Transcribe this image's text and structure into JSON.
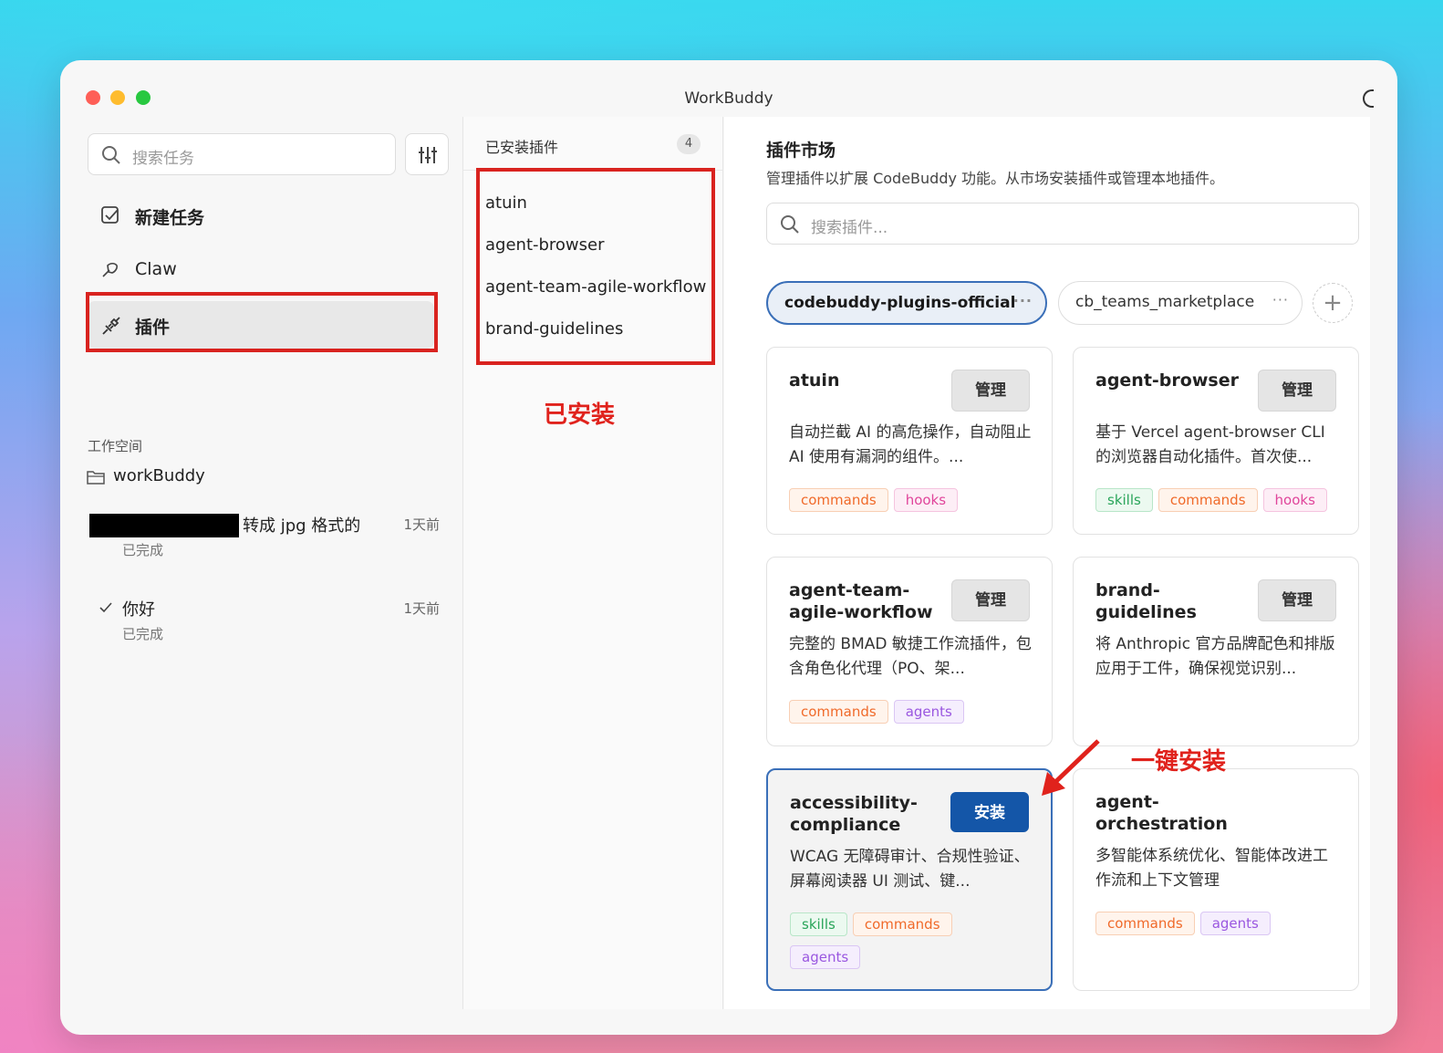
{
  "window": {
    "title": "WorkBuddy"
  },
  "sidebar": {
    "search_placeholder": "搜索任务",
    "nav": [
      {
        "label": "新建任务",
        "icon": "new-task-icon"
      },
      {
        "label": "Claw",
        "icon": "claw-icon"
      },
      {
        "label": "插件",
        "icon": "plugin-icon"
      }
    ],
    "workspace_label": "工作空间",
    "workspace_folder": "workBuddy",
    "tasks": [
      {
        "title": "转成 jpg 格式的",
        "time": "1天前",
        "status": "已完成"
      },
      {
        "title": "你好",
        "time": "1天前",
        "status": "已完成"
      }
    ]
  },
  "installed": {
    "header": "已安装插件",
    "count": "4",
    "items": [
      "atuin",
      "agent-browser",
      "agent-team-agile-workflow",
      "brand-guidelines"
    ],
    "annotation": "已安装"
  },
  "market": {
    "title": "插件市场",
    "description": "管理插件以扩展 CodeBuddy 功能。从市场安装插件或管理本地插件。",
    "search_placeholder": "搜索插件...",
    "sources": [
      "codebuddy-plugins-official",
      "cb_teams_marketplace"
    ],
    "add_label": "+",
    "annotation": "一键安装",
    "cards": [
      {
        "name": "atuin",
        "button": "管理",
        "description": "自动拦截 AI 的高危操作，自动阻止 AI 使用有漏洞的组件。...",
        "tags": [
          "commands",
          "hooks"
        ]
      },
      {
        "name": "agent-browser",
        "button": "管理",
        "description": "基于 Vercel agent-browser CLI 的浏览器自动化插件。首次使...",
        "tags": [
          "skills",
          "commands",
          "hooks"
        ]
      },
      {
        "name": "agent-team-agile-workflow",
        "button": "管理",
        "description": "完整的 BMAD 敏捷工作流插件，包含角色化代理（PO、架...",
        "tags": [
          "commands",
          "agents"
        ]
      },
      {
        "name": "brand-guidelines",
        "button": "管理",
        "description": "将 Anthropic 官方品牌配色和排版应用于工件，确保视觉识别...",
        "tags": []
      },
      {
        "name": "accessibility-compliance",
        "button": "安装",
        "description": "WCAG 无障碍审计、合规性验证、屏幕阅读器 UI 测试、键...",
        "tags": [
          "skills",
          "commands",
          "agents"
        ]
      },
      {
        "name": "agent-orchestration",
        "button": "",
        "description": "多智能体系统优化、智能体改进工作流和上下文管理",
        "tags": [
          "commands",
          "agents"
        ]
      }
    ]
  },
  "colors": {
    "accent": "#1456a8",
    "highlight": "#d9231f",
    "annotation": "#e0221c",
    "tab_active_border": "#3a6fb8"
  }
}
